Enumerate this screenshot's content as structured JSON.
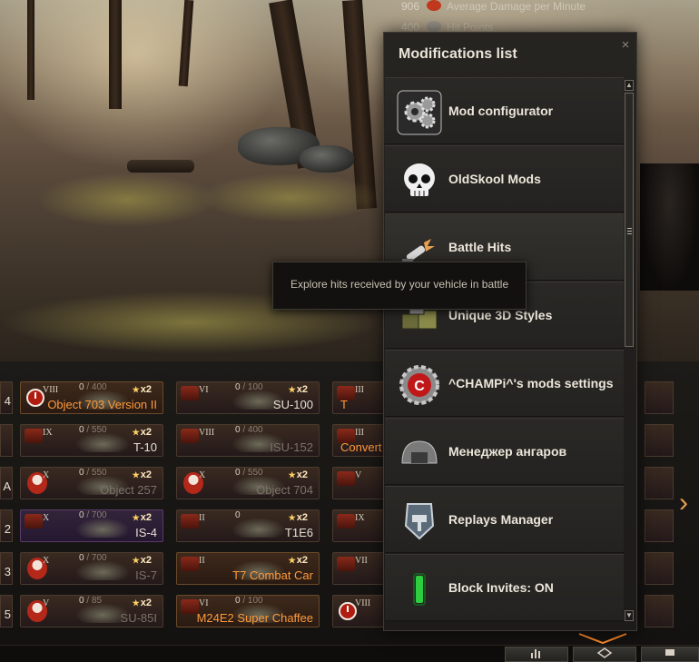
{
  "stats": [
    {
      "value": "906",
      "label": "Average Damage per Minute",
      "icon": "damage-icon"
    },
    {
      "value": "400",
      "label": "Hit Points",
      "icon": "hitpoints-icon"
    }
  ],
  "panel": {
    "title": "Modifications list",
    "close_glyph": "×",
    "items": [
      {
        "label": "Mod configurator",
        "icon": "gears-icon"
      },
      {
        "label": "OldSkool Mods",
        "icon": "skull-icon"
      },
      {
        "label": "Battle Hits",
        "icon": "shell-hit-icon"
      },
      {
        "label": "Unique 3D Styles",
        "icon": "style-crates-icon"
      },
      {
        "label": "^CHAMPi^'s mods settings",
        "icon": "champi-gear-icon"
      },
      {
        "label": "Менеджер ангаров",
        "icon": "hangar-icon"
      },
      {
        "label": "Replays Manager",
        "icon": "replay-tank-icon"
      },
      {
        "label": "Block Invites: ON",
        "icon": "green-indicator-icon"
      }
    ],
    "scroll_up": "▲",
    "scroll_down": "▼"
  },
  "tooltip": {
    "text": "Explore hits received by your vehicle in battle"
  },
  "carousel": {
    "left_slivers": [
      "4",
      "",
      "A",
      "2",
      "3",
      "5"
    ],
    "cards": [
      {
        "tier": "VIII",
        "count": "0",
        "max": "400",
        "name": "Object 703 Version II",
        "name_style": "gold",
        "badge": "clock",
        "multiplier": "x2",
        "style": "premium"
      },
      {
        "tier": "VI",
        "count": "0",
        "max": "100",
        "name": "SU-100",
        "name_style": "normal",
        "badge": "nation",
        "multiplier": "x2",
        "style": "normal"
      },
      {
        "tier": "IX",
        "count": "0",
        "max": "550",
        "name": "T-10",
        "name_style": "normal",
        "badge": "nation",
        "multiplier": "x2",
        "style": "normal"
      },
      {
        "tier": "VIII",
        "count": "0",
        "max": "400",
        "name": "ISU-152",
        "name_style": "dim",
        "badge": "nation",
        "multiplier": "",
        "style": "normal"
      },
      {
        "tier": "X",
        "count": "0",
        "max": "550",
        "name": "Object 257",
        "name_style": "dim",
        "badge": "person",
        "multiplier": "x2",
        "style": "normal"
      },
      {
        "tier": "X",
        "count": "0",
        "max": "550",
        "name": "Object 704",
        "name_style": "dim",
        "badge": "person",
        "multiplier": "x2",
        "style": "normal"
      },
      {
        "tier": "X",
        "count": "0",
        "max": "700",
        "name": "IS-4",
        "name_style": "normal",
        "badge": "nation",
        "multiplier": "x2",
        "style": "elite"
      },
      {
        "tier": "II",
        "count": "0",
        "max": "",
        "name": "T1E6",
        "name_style": "normal",
        "badge": "nation",
        "multiplier": "x2",
        "style": "normal"
      },
      {
        "tier": "X",
        "count": "0",
        "max": "700",
        "name": "IS-7",
        "name_style": "dim",
        "badge": "person",
        "multiplier": "x2",
        "style": "normal"
      },
      {
        "tier": "II",
        "count": "",
        "max": "",
        "name": "T7 Combat Car",
        "name_style": "gold",
        "badge": "nation",
        "multiplier": "x2",
        "style": "premium"
      },
      {
        "tier": "V",
        "count": "0",
        "max": "85",
        "name": "SU-85I",
        "name_style": "dim",
        "badge": "person",
        "multiplier": "x2",
        "style": "normal"
      },
      {
        "tier": "VI",
        "count": "0",
        "max": "100",
        "name": "M24E2 Super Chaffee",
        "name_style": "gold",
        "badge": "nation",
        "multiplier": "",
        "style": "premium"
      }
    ],
    "partial_cards": [
      {
        "tier": "III",
        "name": "T",
        "badge": "nation"
      },
      {
        "tier": "III",
        "name": "Convert",
        "badge": "nation"
      },
      {
        "tier": "V",
        "name": "",
        "badge": "nation"
      },
      {
        "tier": "IX",
        "name": "",
        "badge": "nation"
      },
      {
        "tier": "VII",
        "name": "",
        "badge": "nation"
      },
      {
        "tier": "VIII",
        "name": "",
        "badge": "clock"
      }
    ],
    "right_slivers": [
      "clock",
      "clock",
      "person",
      "clock",
      "person",
      "nation"
    ],
    "right_arrow": "›"
  },
  "bottom_bar": {
    "buttons": [
      "stats-icon",
      "filter-icon",
      "flag-icon"
    ]
  },
  "colors": {
    "accent": "#ff9a3a",
    "panel_bg": "#262421",
    "text": "#ece6da"
  }
}
